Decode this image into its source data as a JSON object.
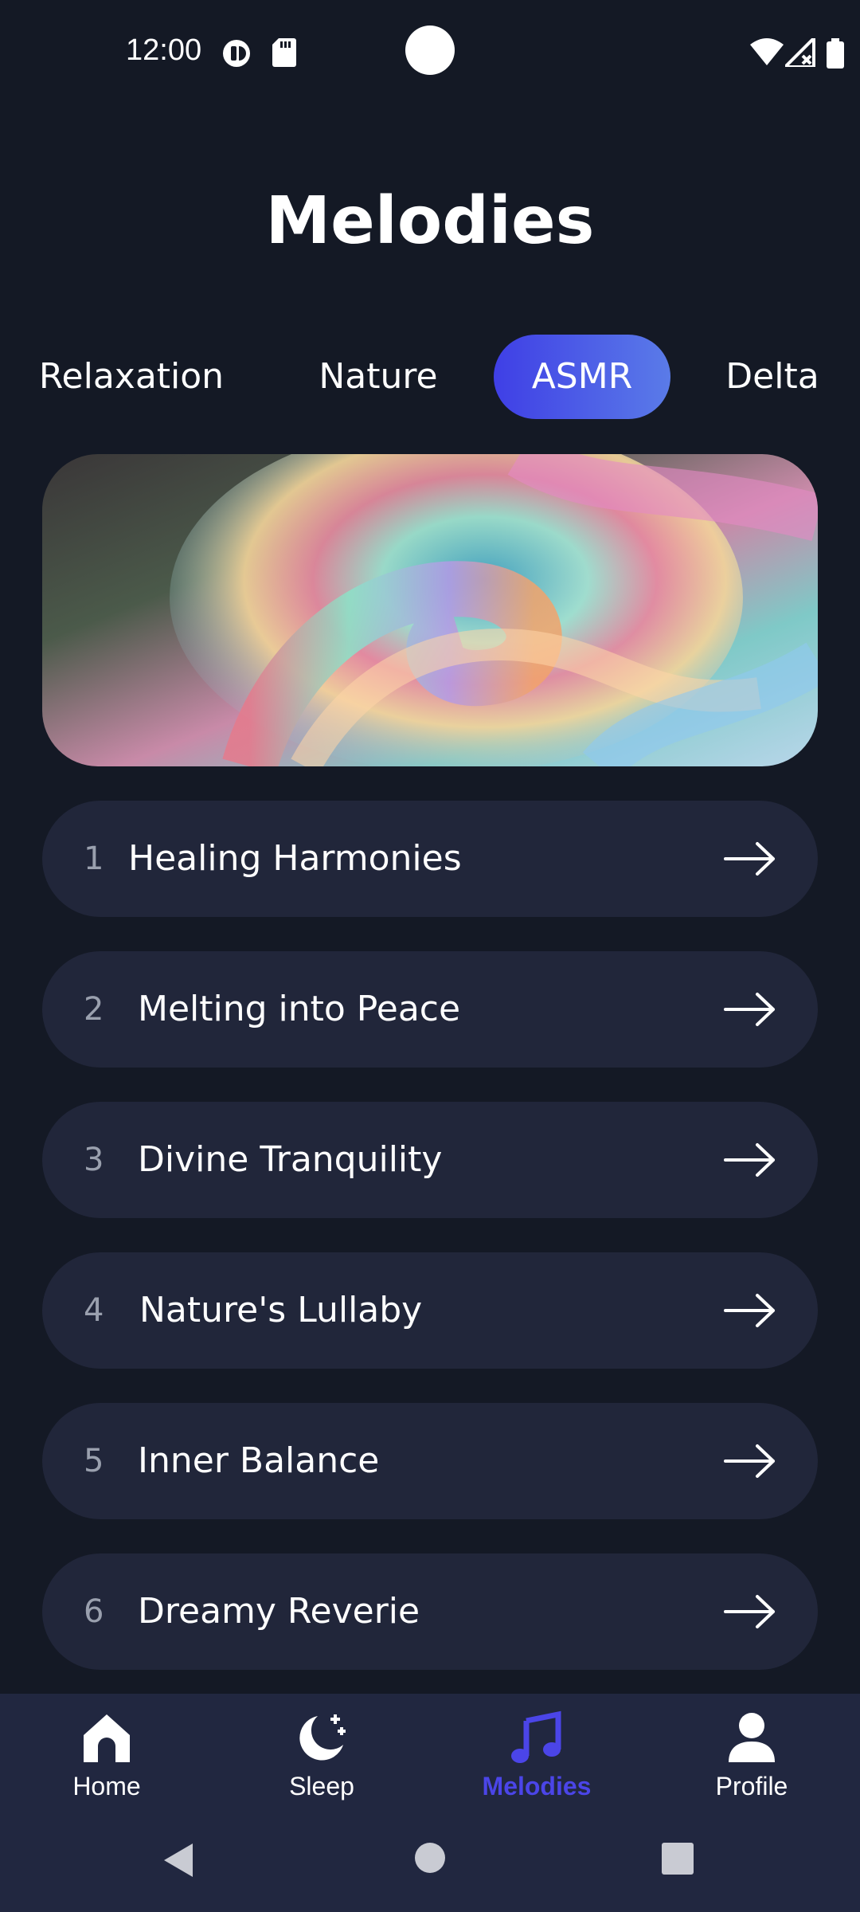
{
  "status_bar": {
    "time": "12:00",
    "icons": [
      "data-saver-icon",
      "sd-card-icon",
      "wifi-icon",
      "signal-icon",
      "battery-icon"
    ]
  },
  "page": {
    "title": "Melodies"
  },
  "tabs": [
    {
      "label": "Relaxation",
      "active": false
    },
    {
      "label": "Nature",
      "active": false
    },
    {
      "label": "ASMR",
      "active": true
    },
    {
      "label": "Delta",
      "active": false
    }
  ],
  "hero": {
    "image": "abstract-iridescent-swirl"
  },
  "tracks": [
    {
      "number": "1",
      "title": "Healing Harmonies"
    },
    {
      "number": "2",
      "title": "Melting into Peace"
    },
    {
      "number": "3",
      "title": "Divine Tranquility"
    },
    {
      "number": "4",
      "title": "Nature's Lullaby"
    },
    {
      "number": "5",
      "title": "Inner Balance"
    },
    {
      "number": "6",
      "title": "Dreamy Reverie"
    }
  ],
  "bottom_nav": [
    {
      "label": "Home",
      "icon": "home-icon",
      "active": false
    },
    {
      "label": "Sleep",
      "icon": "moon-stars-icon",
      "active": false
    },
    {
      "label": "Melodies",
      "icon": "music-note-icon",
      "active": true
    },
    {
      "label": "Profile",
      "icon": "person-icon",
      "active": false
    }
  ],
  "colors": {
    "background": "#141925",
    "card": "#21263a",
    "accent": "#4b45e8",
    "nav_bg": "#212740"
  }
}
